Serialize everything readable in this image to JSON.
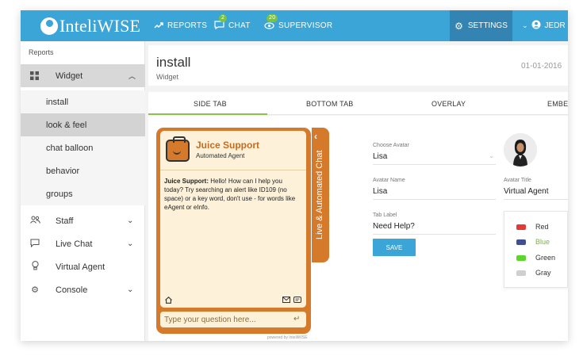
{
  "brand": {
    "name": "InteliWISE"
  },
  "nav": {
    "reports": "REPORTS",
    "chat": "CHAT",
    "chat_badge": "2",
    "supervisor": "SUPERVISOR",
    "supervisor_badge": "20",
    "settings": "SETTINGS",
    "user": "JEDR"
  },
  "sidebar": {
    "section_title": "Reports",
    "widget": {
      "label": "Widget"
    },
    "sub_items": [
      {
        "label": "install"
      },
      {
        "label": "look & feel"
      },
      {
        "label": "chat balloon"
      },
      {
        "label": "behavior"
      },
      {
        "label": "groups"
      }
    ],
    "main_items": [
      {
        "label": "Staff"
      },
      {
        "label": "Live Chat"
      },
      {
        "label": "Virtual Agent"
      },
      {
        "label": "Console"
      }
    ]
  },
  "page": {
    "title": "install",
    "breadcrumb": "Widget",
    "date": "01-01-2016"
  },
  "tabs": [
    {
      "label": "SIDE TAB"
    },
    {
      "label": "BOTTOM TAB"
    },
    {
      "label": "OVERLAY"
    },
    {
      "label": "EMBE"
    }
  ],
  "chat_widget": {
    "agent_name": "Juice Support",
    "agent_role": "Automated Agent",
    "message_sender": "Juice Support:",
    "message_text": " Hello! How can I help you today? Try searching an alert like ID109 (no space) or a key word, don't use - for words like eAgent or eInfo.",
    "side_label": "Live & Automated Chat",
    "input_placeholder": "Type your question here...",
    "powered_by": "powered by InteliWISE"
  },
  "form": {
    "choose_avatar_label": "Choose Avatar",
    "choose_avatar_value": "Lisa",
    "avatar_name_label": "Avatar Name",
    "avatar_name_value": "Lisa",
    "tab_label_label": "Tab Label",
    "tab_label_value": "Need Help?",
    "avatar_title_label": "Avatar Title",
    "avatar_title_value": "Virtual Agent",
    "save_label": "SAVE"
  },
  "colors": [
    {
      "name": "Red",
      "hex": "#e53935",
      "text_hex": "#333333"
    },
    {
      "name": "Blue",
      "hex": "#3f4f8f",
      "text_hex": "#7cb342"
    },
    {
      "name": "Green",
      "hex": "#5cd62a",
      "text_hex": "#333333"
    },
    {
      "name": "Gray",
      "hex": "#cfcfcf",
      "text_hex": "#333333"
    }
  ],
  "theme": {
    "accent": "#3aa5d6",
    "settings_bg": "#3384b3",
    "widget_orange": "#d47a2a",
    "tab_underline": "#8bc34a"
  }
}
